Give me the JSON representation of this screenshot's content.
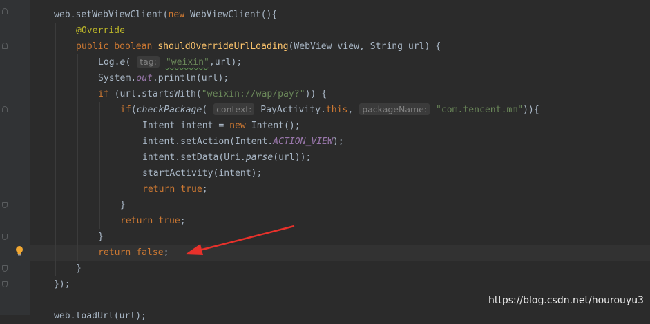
{
  "editor": {
    "lines": [
      {
        "tokens": [
          {
            "t": "web.setWebViewClient(",
            "c": ""
          },
          {
            "t": "new",
            "c": "kw"
          },
          {
            "t": " WebViewClient(){",
            "c": ""
          }
        ]
      },
      {
        "tokens": [
          {
            "t": "@Override",
            "c": "ann"
          }
        ]
      },
      {
        "tokens": [
          {
            "t": "public",
            "c": "kw"
          },
          {
            "t": " ",
            "c": ""
          },
          {
            "t": "boolean",
            "c": "kw"
          },
          {
            "t": " ",
            "c": ""
          },
          {
            "t": "shouldOverrideUrlLoading",
            "c": "fn"
          },
          {
            "t": "(WebView view, String url) {",
            "c": ""
          }
        ]
      },
      {
        "tokens": [
          {
            "t": "Log.",
            "c": ""
          },
          {
            "t": "e",
            "c": "it"
          },
          {
            "t": "( ",
            "c": ""
          },
          {
            "t": "tag:",
            "c": "hint"
          },
          {
            "t": " ",
            "c": ""
          },
          {
            "t": "\"weixin\"",
            "c": "str wavy"
          },
          {
            "t": ",url);",
            "c": ""
          }
        ]
      },
      {
        "tokens": [
          {
            "t": "System.",
            "c": ""
          },
          {
            "t": "out",
            "c": "fld"
          },
          {
            "t": ".println(url);",
            "c": ""
          }
        ]
      },
      {
        "tokens": [
          {
            "t": "if",
            "c": "kw"
          },
          {
            "t": " (url.startsWith(",
            "c": ""
          },
          {
            "t": "\"weixin://wap/pay?\"",
            "c": "str"
          },
          {
            "t": ")) {",
            "c": ""
          }
        ]
      },
      {
        "tokens": [
          {
            "t": "if",
            "c": "kw"
          },
          {
            "t": "(",
            "c": ""
          },
          {
            "t": "checkPackage",
            "c": "it"
          },
          {
            "t": "( ",
            "c": ""
          },
          {
            "t": "context:",
            "c": "hint"
          },
          {
            "t": " PayActivity.",
            "c": ""
          },
          {
            "t": "this",
            "c": "kw"
          },
          {
            "t": ", ",
            "c": ""
          },
          {
            "t": "packageName:",
            "c": "hint"
          },
          {
            "t": " ",
            "c": ""
          },
          {
            "t": "\"com.tencent.mm\"",
            "c": "str"
          },
          {
            "t": ")){",
            "c": ""
          }
        ]
      },
      {
        "tokens": [
          {
            "t": "Intent intent = ",
            "c": ""
          },
          {
            "t": "new",
            "c": "kw"
          },
          {
            "t": " Intent();",
            "c": ""
          }
        ]
      },
      {
        "tokens": [
          {
            "t": "intent.setAction(Intent.",
            "c": ""
          },
          {
            "t": "ACTION_VIEW",
            "c": "fld"
          },
          {
            "t": ");",
            "c": ""
          }
        ]
      },
      {
        "tokens": [
          {
            "t": "intent.setData(Uri.",
            "c": ""
          },
          {
            "t": "parse",
            "c": "it"
          },
          {
            "t": "(url));",
            "c": ""
          }
        ]
      },
      {
        "tokens": [
          {
            "t": "startActivity(intent);",
            "c": ""
          }
        ]
      },
      {
        "tokens": [
          {
            "t": "return",
            "c": "kw"
          },
          {
            "t": " ",
            "c": ""
          },
          {
            "t": "true",
            "c": "kw"
          },
          {
            "t": ";",
            "c": ""
          }
        ]
      },
      {
        "tokens": [
          {
            "t": "}",
            "c": ""
          }
        ]
      },
      {
        "tokens": [
          {
            "t": "return",
            "c": "kw"
          },
          {
            "t": " ",
            "c": ""
          },
          {
            "t": "true",
            "c": "kw"
          },
          {
            "t": ";",
            "c": ""
          }
        ]
      },
      {
        "tokens": [
          {
            "t": "}",
            "c": ""
          }
        ]
      },
      {
        "tokens": [
          {
            "t": "return",
            "c": "kw"
          },
          {
            "t": " ",
            "c": ""
          },
          {
            "t": "false",
            "c": "kw"
          },
          {
            "t": ";",
            "c": ""
          }
        ]
      },
      {
        "tokens": [
          {
            "t": "}",
            "c": ""
          }
        ]
      },
      {
        "tokens": [
          {
            "t": "});",
            "c": ""
          }
        ]
      },
      {
        "tokens": []
      },
      {
        "tokens": [
          {
            "t": "web.loadUrl(url);",
            "c": ""
          }
        ]
      }
    ],
    "highlighted_line": 16,
    "colors": {
      "background": "#2b2b2b",
      "keyword": "#cc7832",
      "string": "#6a8759",
      "method_decl": "#ffc66d",
      "annotation": "#bbb529",
      "field": "#9876aa",
      "text": "#a9b7c6",
      "arrow": "#e8312b"
    }
  },
  "watermark": "https://blog.csdn.net/hourouyu3"
}
